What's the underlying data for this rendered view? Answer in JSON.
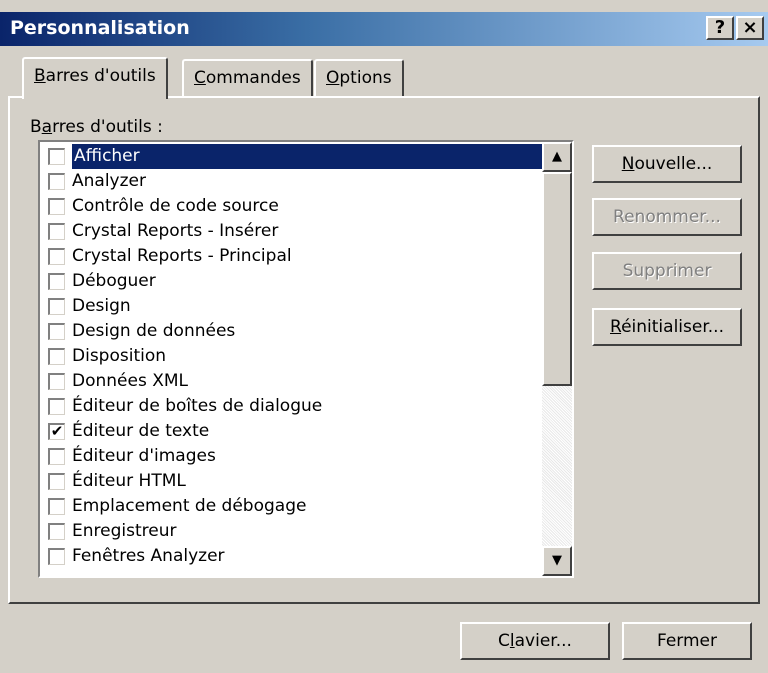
{
  "window": {
    "title": "Personnalisation",
    "help_label": "?",
    "close_label": "×"
  },
  "tabs": [
    {
      "label": "Barres d'outils",
      "mnemonic": "B",
      "rest": "arres d'outils",
      "active": true
    },
    {
      "label": "Commandes",
      "mnemonic": "C",
      "rest": "ommandes",
      "active": false
    },
    {
      "label": "Options",
      "mnemonic": "O",
      "rest": "ptions",
      "active": false
    }
  ],
  "toolbars": {
    "label": "Barres d'outils :",
    "label_pre": "B",
    "label_mnemonic": "a",
    "label_post": "rres d'outils :",
    "items": [
      {
        "label": "Afficher",
        "checked": false,
        "selected": true
      },
      {
        "label": "Analyzer",
        "checked": false,
        "selected": false
      },
      {
        "label": "Contrôle de code source",
        "checked": false,
        "selected": false
      },
      {
        "label": "Crystal Reports - Insérer",
        "checked": false,
        "selected": false
      },
      {
        "label": "Crystal Reports - Principal",
        "checked": false,
        "selected": false
      },
      {
        "label": "Déboguer",
        "checked": false,
        "selected": false
      },
      {
        "label": "Design",
        "checked": false,
        "selected": false
      },
      {
        "label": "Design de données",
        "checked": false,
        "selected": false
      },
      {
        "label": "Disposition",
        "checked": false,
        "selected": false
      },
      {
        "label": "Données XML",
        "checked": false,
        "selected": false
      },
      {
        "label": "Éditeur de boîtes de dialogue",
        "checked": false,
        "selected": false
      },
      {
        "label": "Éditeur de texte",
        "checked": true,
        "selected": false
      },
      {
        "label": "Éditeur d'images",
        "checked": false,
        "selected": false
      },
      {
        "label": "Éditeur HTML",
        "checked": false,
        "selected": false
      },
      {
        "label": "Emplacement de débogage",
        "checked": false,
        "selected": false
      },
      {
        "label": "Enregistreur",
        "checked": false,
        "selected": false
      },
      {
        "label": "Fenêtres Analyzer",
        "checked": false,
        "selected": false
      }
    ]
  },
  "buttons": {
    "new": {
      "label": "Nouvelle...",
      "mnemonic": "N",
      "rest": "ouvelle..."
    },
    "rename": {
      "label": "Renommer..."
    },
    "delete": {
      "label": "Supprimer"
    },
    "reset": {
      "label": "Réinitialiser...",
      "mnemonic": "R",
      "rest": "éinitialiser..."
    },
    "keyboard": {
      "label": "Clavier...",
      "pre": "C",
      "mnemonic": "l",
      "rest": "avier..."
    },
    "close": {
      "label": "Fermer"
    }
  },
  "scrollbar": {
    "up_icon": "arrow-up-icon",
    "down_icon": "arrow-down-icon"
  }
}
